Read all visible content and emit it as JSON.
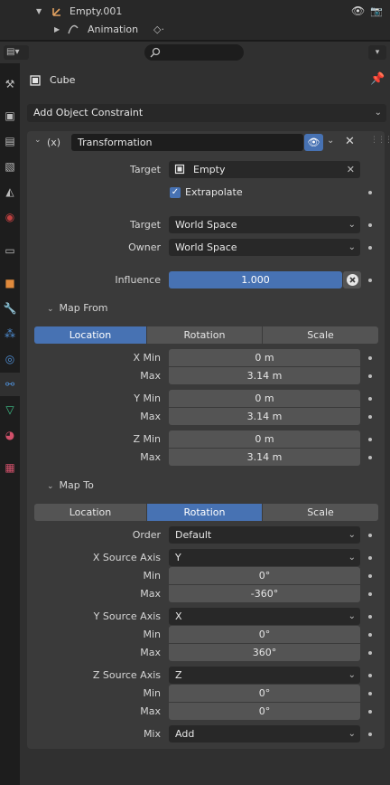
{
  "outliner": {
    "row1": "Empty.001",
    "row2": "Animation"
  },
  "header": {
    "search_placeholder": ""
  },
  "object_name": "Cube",
  "add_constraint": "Add Object Constraint",
  "constraint": {
    "prefix": "(x)",
    "name": "Transformation",
    "target_label": "Target",
    "target_value": "Empty",
    "extrapolate": "Extrapolate",
    "target_space_label": "Target",
    "target_space": "World Space",
    "owner_space_label": "Owner",
    "owner_space": "World Space",
    "influence_label": "Influence",
    "influence": "1.000",
    "influence_fraction": 1.0,
    "map_from": {
      "title": "Map From",
      "tabs": [
        "Location",
        "Rotation",
        "Scale"
      ],
      "active": 0,
      "x_min_label": "X Min",
      "x_min": "0 m",
      "x_max_label": "Max",
      "x_max": "3.14 m",
      "y_min_label": "Y Min",
      "y_min": "0 m",
      "y_max_label": "Max",
      "y_max": "3.14 m",
      "z_min_label": "Z Min",
      "z_min": "0 m",
      "z_max_label": "Max",
      "z_max": "3.14 m"
    },
    "map_to": {
      "title": "Map To",
      "tabs": [
        "Location",
        "Rotation",
        "Scale"
      ],
      "active": 1,
      "order_label": "Order",
      "order": "Default",
      "x_src_label": "X Source Axis",
      "x_src": "Y",
      "x_min_label": "Min",
      "x_min": "0°",
      "x_max_label": "Max",
      "x_max": "-360°",
      "y_src_label": "Y Source Axis",
      "y_src": "X",
      "y_min_label": "Min",
      "y_min": "0°",
      "y_max_label": "Max",
      "y_max": "360°",
      "z_src_label": "Z Source Axis",
      "z_src": "Z",
      "z_min_label": "Min",
      "z_min": "0°",
      "z_max_label": "Max",
      "z_max": "0°",
      "mix_label": "Mix",
      "mix": "Add"
    }
  },
  "colors": {
    "accent": "#4772b3",
    "panel": "#3a3a3a",
    "field": "#545454",
    "dropdown": "#282828"
  }
}
